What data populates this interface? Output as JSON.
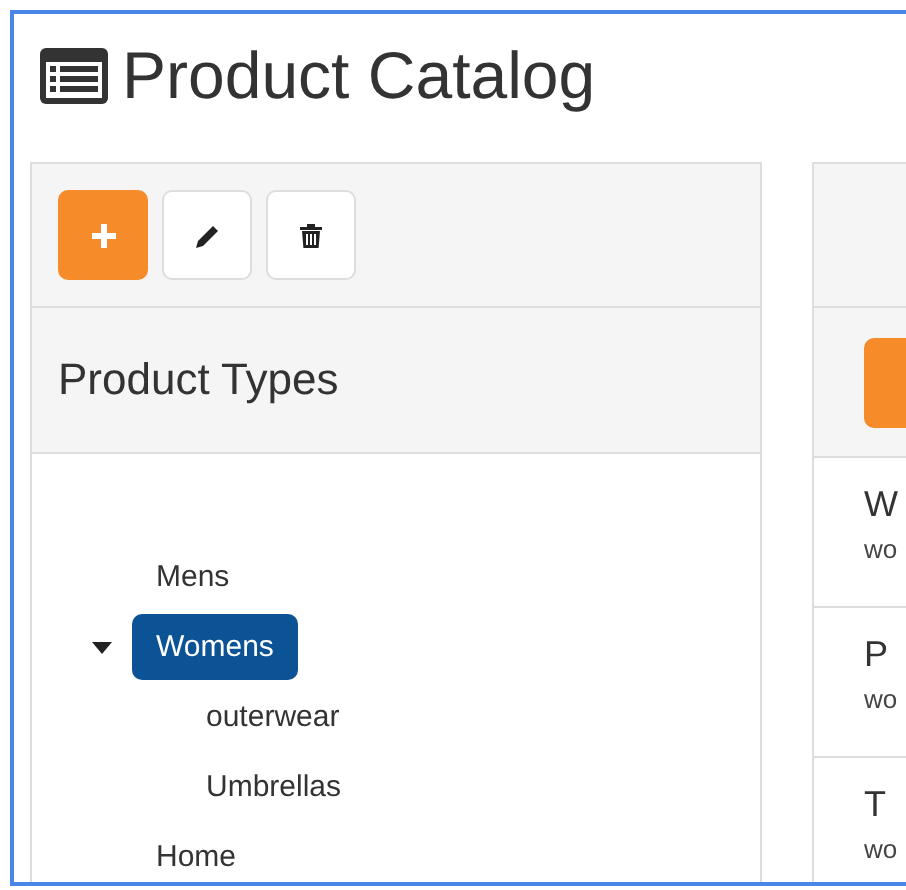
{
  "page": {
    "title": "Product Catalog"
  },
  "types_panel": {
    "toolbar": [
      {
        "kind": "add"
      },
      {
        "kind": "edit"
      },
      {
        "kind": "delete"
      }
    ],
    "heading": "Product Types",
    "tree": [
      {
        "label": "Mens",
        "expanded": false,
        "selected": false
      },
      {
        "label": "Womens",
        "expanded": true,
        "selected": true,
        "children": [
          {
            "label": "outerwear",
            "selected": false
          },
          {
            "label": "Umbrellas",
            "selected": false
          }
        ]
      },
      {
        "label": "Home",
        "expanded": false,
        "selected": false
      }
    ]
  },
  "products_panel": {
    "items": [
      {
        "name": "W",
        "detail": "wo"
      },
      {
        "name": "P",
        "detail": "wo"
      },
      {
        "name": "T",
        "detail": "wo"
      }
    ]
  }
}
